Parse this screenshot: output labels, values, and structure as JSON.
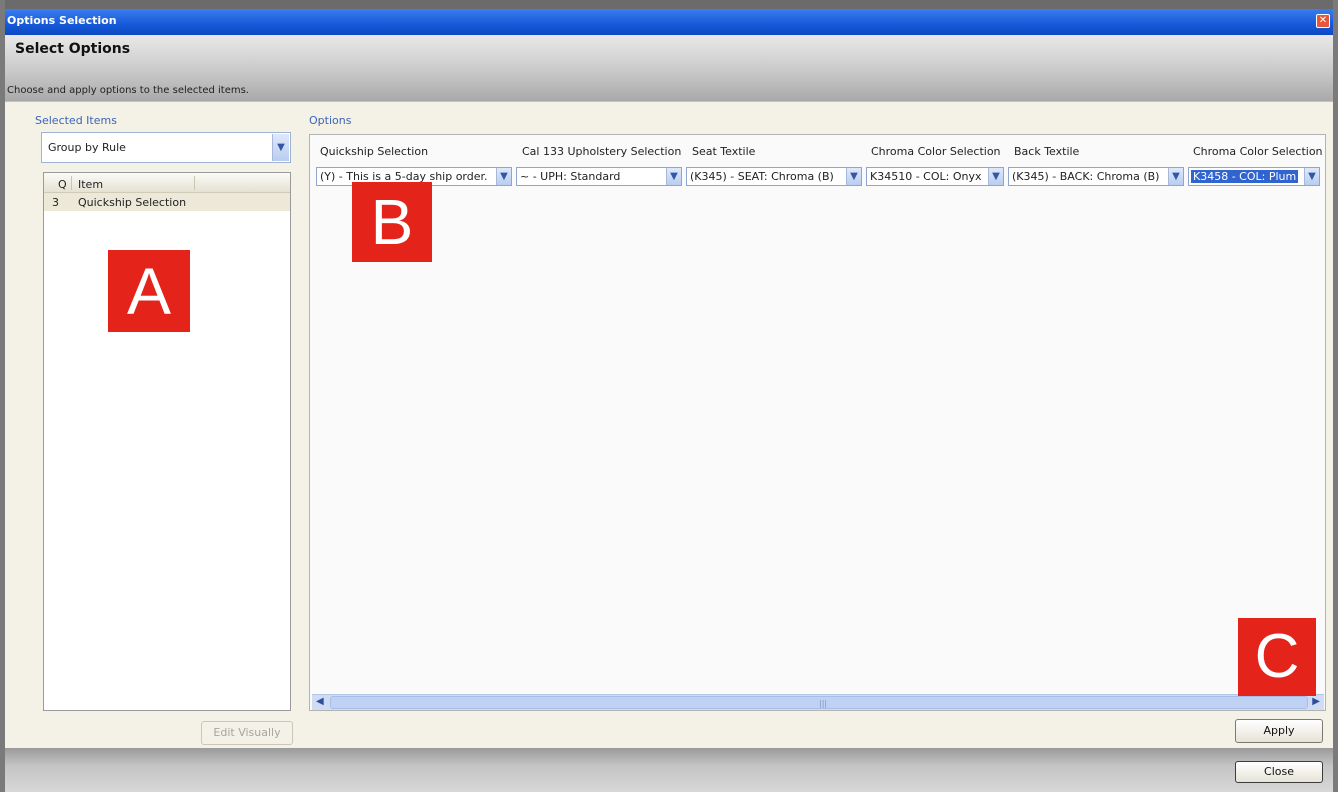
{
  "window": {
    "title": "Options Selection",
    "close_glyph": "✕"
  },
  "header": {
    "title": "Select Options",
    "subtitle": "Choose and apply options to the selected items."
  },
  "selected_items": {
    "label": "Selected Items",
    "group_by": "Group by Rule",
    "columns": [
      "Q",
      "Item"
    ],
    "rows": [
      {
        "q": "3",
        "item": "Quickship Selection"
      }
    ],
    "edit_visually_label": "Edit Visually"
  },
  "options": {
    "label": "Options",
    "columns": [
      {
        "header": "Quickship Selection",
        "value": "(Y) - This is a 5-day ship order."
      },
      {
        "header": "Cal 133 Upholstery Selection",
        "value": "~ - UPH: Standard"
      },
      {
        "header": "Seat Textile",
        "value": "(K345) - SEAT: Chroma (B)"
      },
      {
        "header": "Chroma Color Selection",
        "value": "K34510 - COL: Onyx"
      },
      {
        "header": "Back Textile",
        "value": "(K345) - BACK: Chroma (B)"
      },
      {
        "header": "Chroma Color Selection",
        "value": "K3458 - COL: Plum"
      }
    ]
  },
  "buttons": {
    "apply": "Apply",
    "close": "Close"
  },
  "markers": [
    "A",
    "B",
    "C"
  ],
  "icons": {
    "dropdown": "chevron-down-icon",
    "scroll_left": "arrow-left-icon",
    "scroll_right": "arrow-right-icon"
  }
}
